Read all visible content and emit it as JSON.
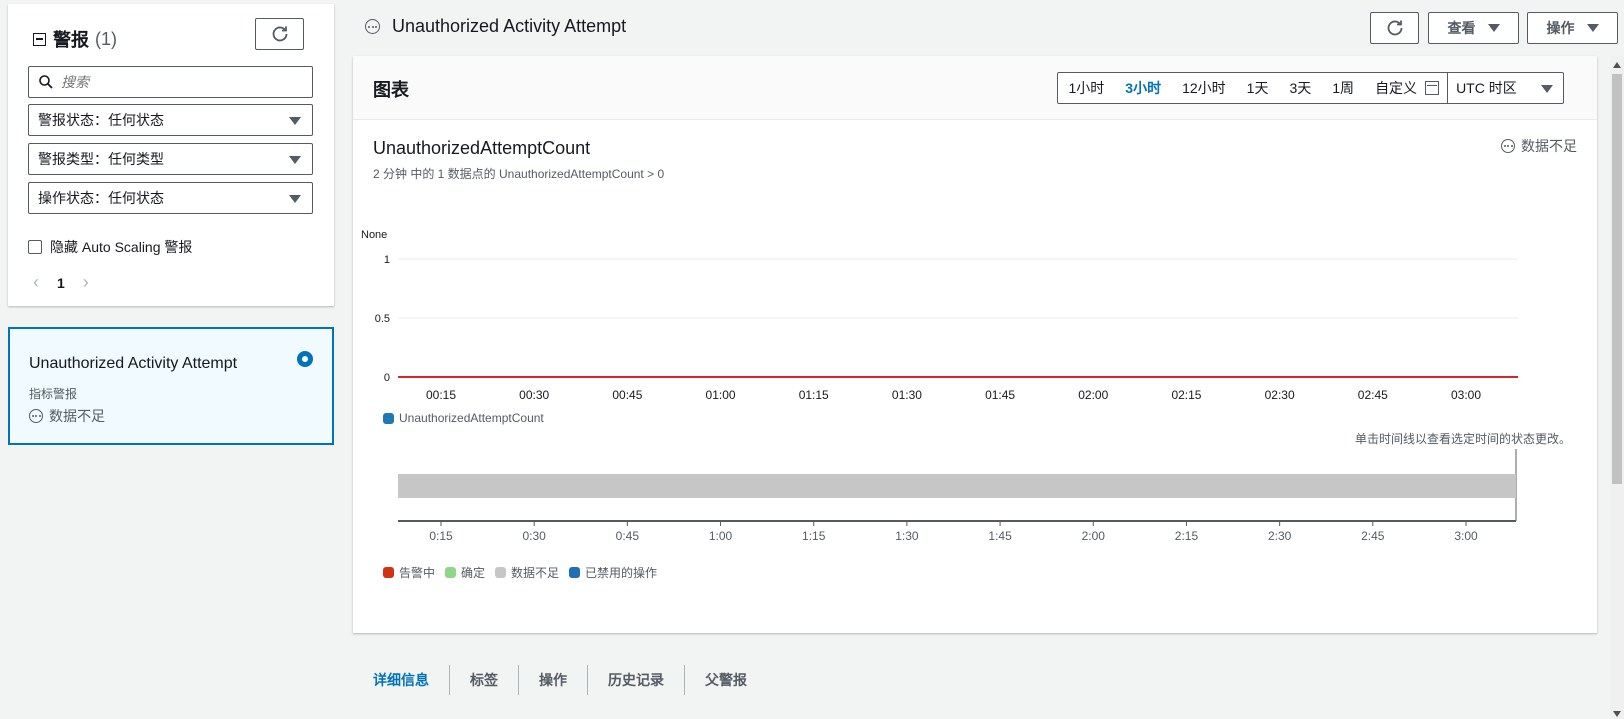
{
  "left_panel": {
    "title": "警报",
    "count": "(1)",
    "search_placeholder": "搜索",
    "filters": [
      {
        "label": "警报状态：任何状态"
      },
      {
        "label": "警报类型：任何类型"
      },
      {
        "label": "操作状态：任何状态"
      }
    ],
    "hide_autoscaling_label": "隐藏 Auto Scaling 警报",
    "page": "1",
    "alarm": {
      "name": "Unauthorized Activity Attempt",
      "type": "指标警报",
      "state": "数据不足"
    }
  },
  "header": {
    "title": "Unauthorized Activity Attempt",
    "view_label": "查看",
    "actions_label": "操作"
  },
  "chart_panel": {
    "title": "图表",
    "time_ranges": [
      "1小时",
      "3小时",
      "12小时",
      "1天",
      "3天",
      "1周",
      "自定义"
    ],
    "active_range": "3小时",
    "timezone": "UTC 时区",
    "metric_title": "UnauthorizedAttemptCount",
    "metric_subtitle": "2 分钟 中的 1 数据点的 UnauthorizedAttemptCount > 0",
    "state_label": "数据不足",
    "click_hint": "单击时间线以查看选定时间的状态更改。"
  },
  "chart_data": [
    {
      "type": "line",
      "ylabel": "None",
      "ylim": [
        0,
        1
      ],
      "y_ticks": [
        "1",
        "0.5",
        "0"
      ],
      "x_ticks": [
        "00:15",
        "00:30",
        "00:45",
        "01:00",
        "01:15",
        "01:30",
        "01:45",
        "02:00",
        "02:15",
        "02:30",
        "02:45",
        "03:00"
      ],
      "threshold": 0,
      "series": [
        {
          "name": "UnauthorizedAttemptCount",
          "values": [],
          "color": "#1f77b4"
        }
      ],
      "threshold_color": "#d62728"
    },
    {
      "type": "timeline",
      "x_ticks": [
        "0:15",
        "0:30",
        "0:45",
        "1:00",
        "1:15",
        "1:30",
        "1:45",
        "2:00",
        "2:15",
        "2:30",
        "2:45",
        "3:00"
      ],
      "segments": [
        {
          "state": "数据不足",
          "from": "start",
          "to": "end"
        }
      ],
      "legend": [
        {
          "name": "告警中",
          "color": "#d13212"
        },
        {
          "name": "确定",
          "color": "#8fd786"
        },
        {
          "name": "数据不足",
          "color": "#c6c6c6"
        },
        {
          "name": "已禁用的操作",
          "color": "#1f6fb4"
        }
      ]
    }
  ],
  "tabs": [
    "详细信息",
    "标签",
    "操作",
    "历史记录",
    "父警报"
  ]
}
